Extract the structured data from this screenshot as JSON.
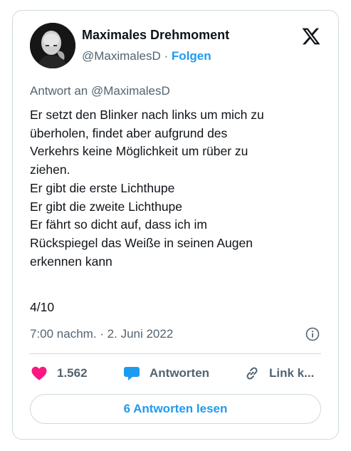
{
  "author": {
    "name": "Maximales Drehmoment",
    "handle": "@MaximalesD",
    "separator": "·",
    "follow_label": "Folgen"
  },
  "reply_to": "Antwort an @MaximalesD",
  "body_lines": [
    "Er setzt den Blinker nach links um mich zu",
    "überholen, findet aber aufgrund des",
    "Verkehrs keine Möglichkeit um rüber zu",
    "ziehen.",
    "Er gibt die erste Lichthupe",
    "Er gibt die zweite Lichthupe",
    "Er fährt so dicht auf, dass ich im",
    "Rückspiegel das Weiße in seinen Augen",
    "erkennen kann"
  ],
  "thread_number": "4/10",
  "timestamp": "7:00 nachm. · 2. Juni 2022",
  "actions": {
    "likes": "1.562",
    "reply_label": "Antworten",
    "link_label": "Link k..."
  },
  "read_replies_label": "6 Antworten lesen",
  "icons": [
    "x-logo-icon",
    "info-icon",
    "heart-icon",
    "reply-bubble-icon",
    "link-icon"
  ],
  "colors": {
    "accent": "#1d9bf0",
    "like": "#f91880",
    "text": "#0f1419",
    "secondary": "#536471",
    "border": "#cfd9de"
  }
}
